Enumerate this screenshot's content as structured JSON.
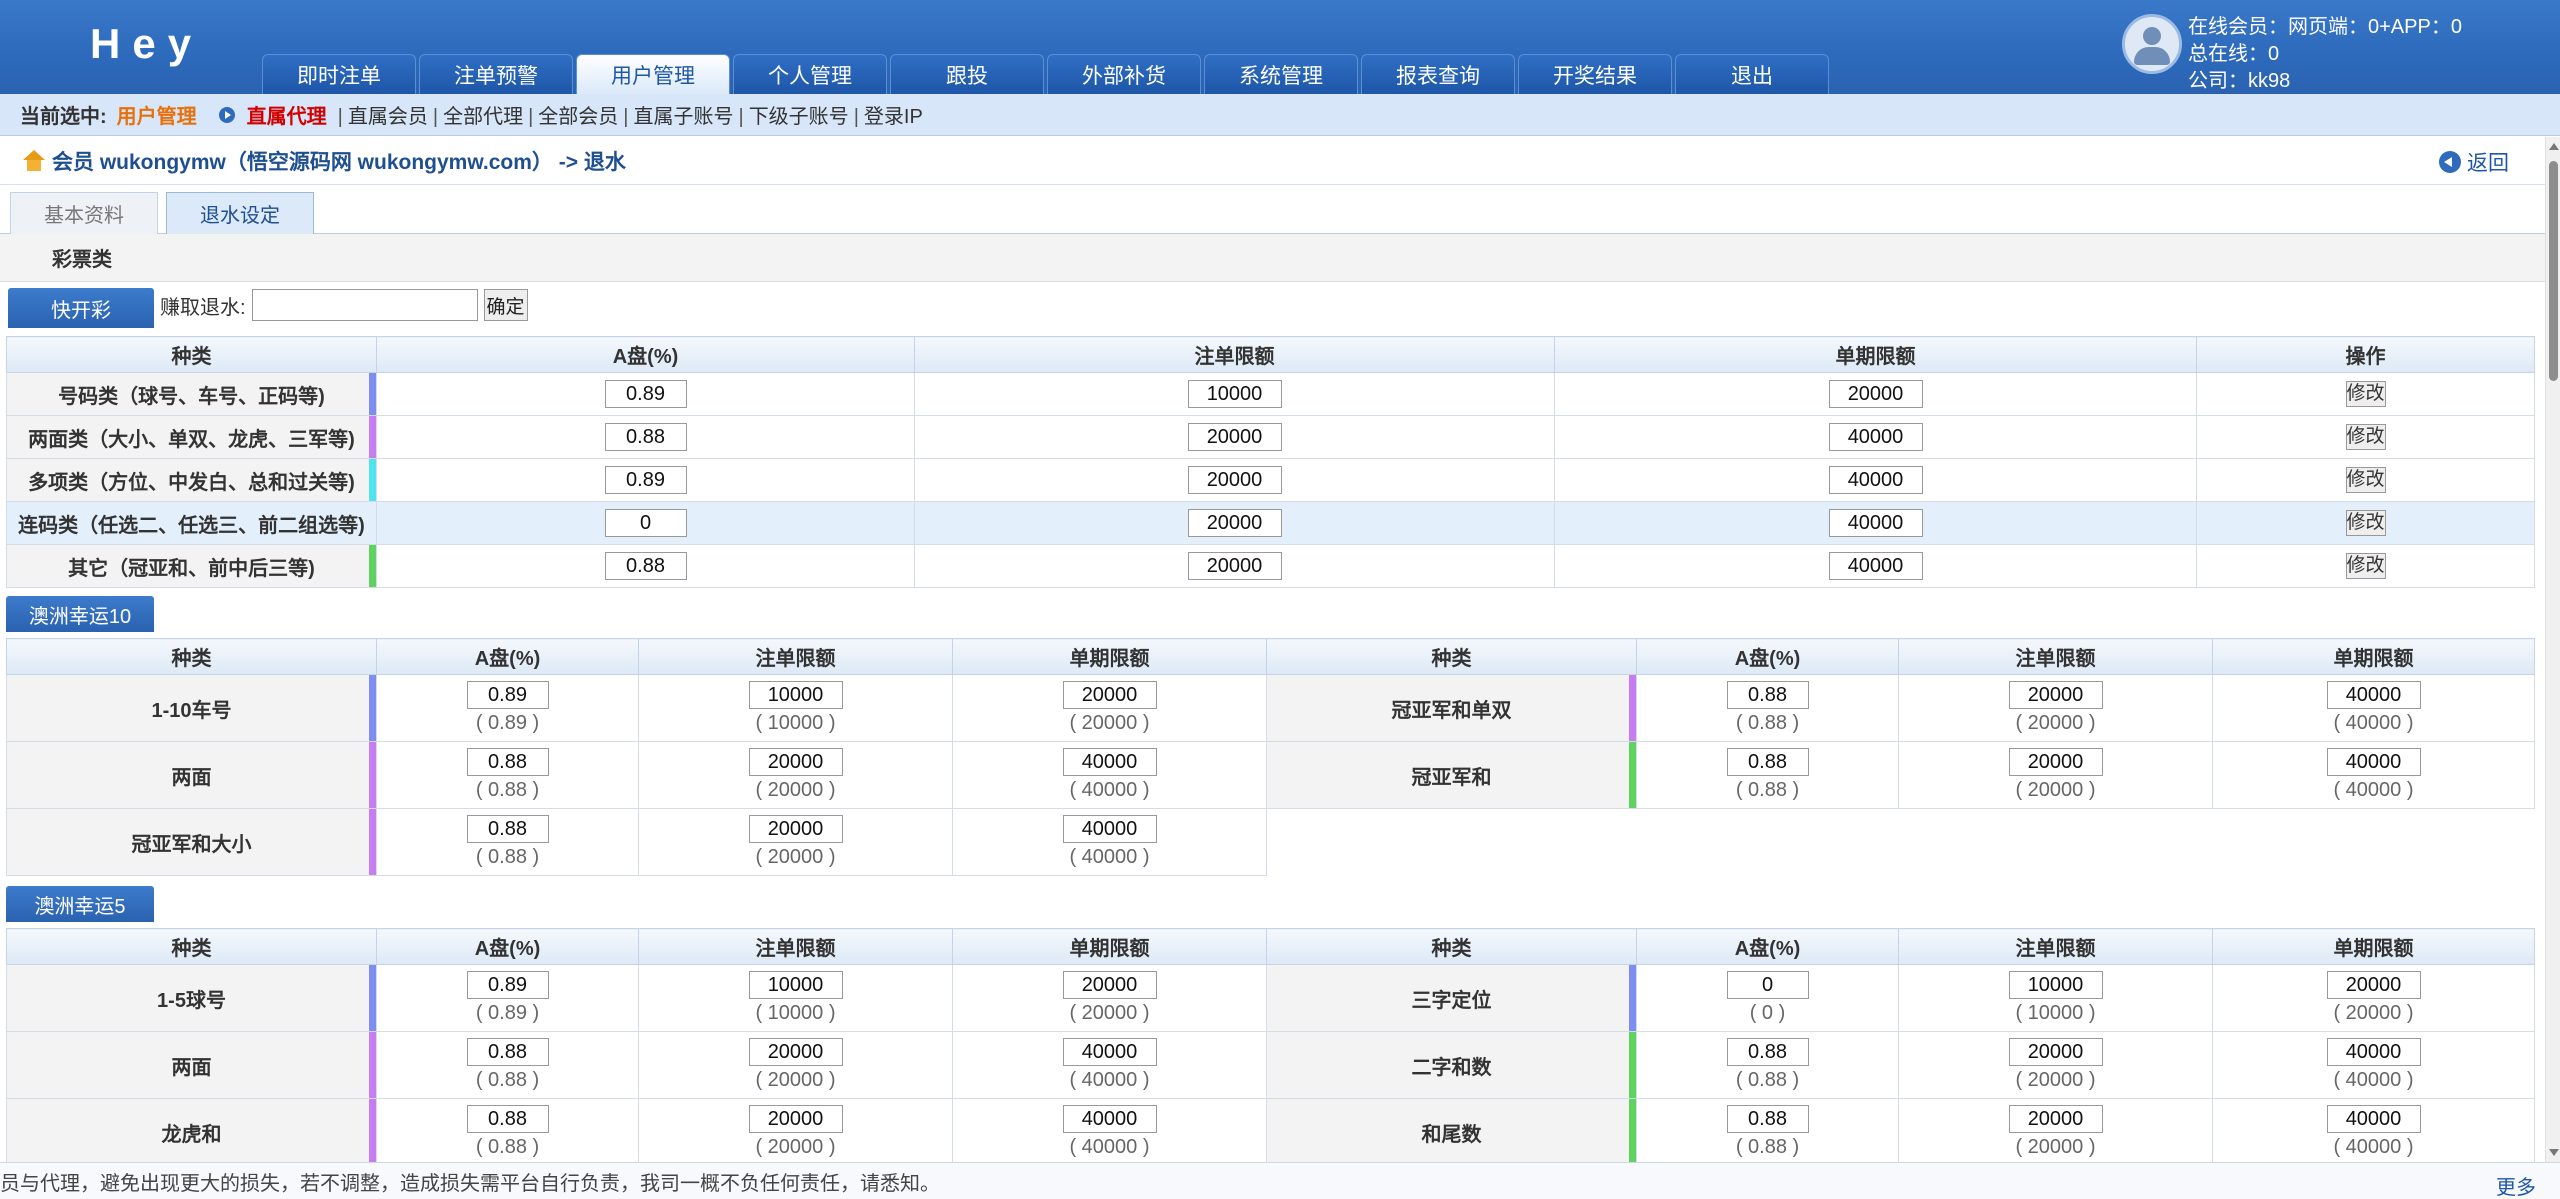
{
  "header": {
    "logo": "Hey",
    "nav": [
      "即时注单",
      "注单预警",
      "用户管理",
      "个人管理",
      "跟投",
      "外部补货",
      "系统管理",
      "报表查询",
      "开奖结果",
      "退出"
    ],
    "active_nav": 2,
    "online": [
      "在线会员：网页端：0+APP：0",
      "总在线：0",
      "公司：kk98"
    ]
  },
  "subbar": {
    "label": "当前选中:",
    "current": "用户管理",
    "active": "直属代理",
    "links": [
      "直属会员",
      "全部代理",
      "全部会员",
      "直属子账号",
      "下级子账号",
      "登录IP"
    ]
  },
  "crumb": {
    "text": "会员 wukongymw（悟空源码网 wukongymw.com） -> 退水",
    "back": "返回"
  },
  "tabs": [
    "基本资料",
    "退水设定"
  ],
  "category": "彩票类",
  "kuai": {
    "title": "快开彩",
    "label": "赚取退水:",
    "confirm": "确定",
    "headers": [
      "种类",
      "A盘(%)",
      "注单限额",
      "单期限额",
      "操作"
    ],
    "rows": [
      {
        "kind": "号码类（球号、车号、正码等)",
        "a": "0.89",
        "bet": "10000",
        "period": "20000",
        "color": "#7d8ef0"
      },
      {
        "kind": "两面类（大小、单双、龙虎、三军等)",
        "a": "0.88",
        "bet": "20000",
        "period": "40000",
        "color": "#c77cf0"
      },
      {
        "kind": "多项类（方位、中发白、总和过关等)",
        "a": "0.89",
        "bet": "20000",
        "period": "40000",
        "color": "#4fe3f0"
      },
      {
        "kind": "连码类（任选二、任选三、前二组选等)",
        "a": "0",
        "bet": "20000",
        "period": "40000",
        "color": ""
      },
      {
        "kind": "其它（冠亚和、前中后三等)",
        "a": "0.88",
        "bet": "20000",
        "period": "40000",
        "color": "#5fd35f"
      }
    ],
    "edit": "修改"
  },
  "g10": {
    "title": "澳洲幸运10",
    "headers": [
      "种类",
      "A盘(%)",
      "注单限额",
      "单期限额"
    ],
    "left": [
      {
        "kind": "1-10车号",
        "a": "0.89",
        "a2": "( 0.89 )",
        "bet": "10000",
        "bet2": "( 10000 )",
        "period": "20000",
        "period2": "( 20000 )",
        "color": "#7d8ef0"
      },
      {
        "kind": "两面",
        "a": "0.88",
        "a2": "( 0.88 )",
        "bet": "20000",
        "bet2": "( 20000 )",
        "period": "40000",
        "period2": "( 40000 )",
        "color": "#c77cf0"
      },
      {
        "kind": "冠亚军和大小",
        "a": "0.88",
        "a2": "( 0.88 )",
        "bet": "20000",
        "bet2": "( 20000 )",
        "period": "40000",
        "period2": "( 40000 )",
        "color": "#c77cf0"
      }
    ],
    "right": [
      {
        "kind": "冠亚军和单双",
        "a": "0.88",
        "a2": "( 0.88 )",
        "bet": "20000",
        "bet2": "( 20000 )",
        "period": "40000",
        "period2": "( 40000 )",
        "color": "#c77cf0"
      },
      {
        "kind": "冠亚军和",
        "a": "0.88",
        "a2": "( 0.88 )",
        "bet": "20000",
        "bet2": "( 20000 )",
        "period": "40000",
        "period2": "( 40000 )",
        "color": "#5fd35f"
      }
    ]
  },
  "g5": {
    "title": "澳洲幸运5",
    "headers": [
      "种类",
      "A盘(%)",
      "注单限额",
      "单期限额"
    ],
    "left": [
      {
        "kind": "1-5球号",
        "a": "0.89",
        "a2": "( 0.89 )",
        "bet": "10000",
        "bet2": "( 10000 )",
        "period": "20000",
        "period2": "( 20000 )",
        "color": "#7d8ef0"
      },
      {
        "kind": "两面",
        "a": "0.88",
        "a2": "( 0.88 )",
        "bet": "20000",
        "bet2": "( 20000 )",
        "period": "40000",
        "period2": "( 40000 )",
        "color": "#c77cf0"
      },
      {
        "kind": "龙虎和",
        "a": "0.88",
        "a2": "( 0.88 )",
        "bet": "20000",
        "bet2": "( 20000 )",
        "period": "40000",
        "period2": "( 40000 )",
        "color": "#c77cf0"
      }
    ],
    "right": [
      {
        "kind": "三字定位",
        "a": "0",
        "a2": "( 0 )",
        "bet": "10000",
        "bet2": "( 10000 )",
        "period": "20000",
        "period2": "( 20000 )",
        "color": "#7d8ef0"
      },
      {
        "kind": "二字和数",
        "a": "0.88",
        "a2": "( 0.88 )",
        "bet": "20000",
        "bet2": "( 20000 )",
        "period": "40000",
        "period2": "( 40000 )",
        "color": "#5fd35f"
      },
      {
        "kind": "和尾数",
        "a": "0.88",
        "a2": "( 0.88 )",
        "bet": "20000",
        "bet2": "( 20000 )",
        "period": "40000",
        "period2": "( 40000 )",
        "color": "#5fd35f"
      }
    ]
  },
  "notice": {
    "text": "员与代理，避免出现更大的损失，若不调整，造成损失需平台自行负责，我司一概不负任何责任，请悉知。",
    "more": "更多"
  }
}
